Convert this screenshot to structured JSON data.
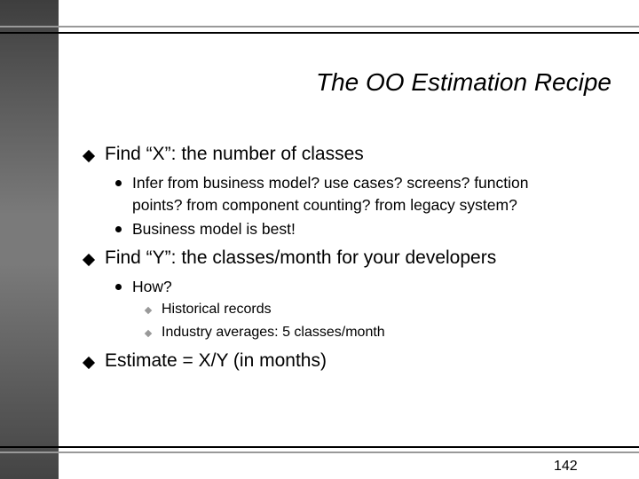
{
  "slide": {
    "title": "The OO Estimation Recipe",
    "page_number": "142",
    "bullets": [
      {
        "text": "Find “X”: the number of classes",
        "icon": "diamond-bullet-icon",
        "sub": [
          {
            "line1": "Infer from business model? use cases? screens? function",
            "line2": "points? from component counting? from legacy system?",
            "icon": "dot-bullet-icon"
          },
          {
            "line1": "Business model is best!",
            "icon": "dot-bullet-icon"
          }
        ]
      },
      {
        "text": "Find “Y”: the classes/month for your developers",
        "icon": "diamond-bullet-icon",
        "sub": [
          {
            "line1": "How?",
            "icon": "dot-bullet-icon",
            "sub": [
              {
                "text": "Historical records",
                "icon": "small-diamond-bullet-icon"
              },
              {
                "text": "Industry averages: 5 classes/month",
                "icon": "small-diamond-bullet-icon"
              }
            ]
          }
        ]
      },
      {
        "text": "Estimate = X/Y (in months)",
        "icon": "diamond-bullet-icon"
      }
    ]
  },
  "colors": {
    "rule_gray": "#999999",
    "rule_black": "#000000",
    "panel_dark": "#3e3e3e",
    "panel_light": "#7a7a7a",
    "sub_sub_bullet": "#999999"
  }
}
